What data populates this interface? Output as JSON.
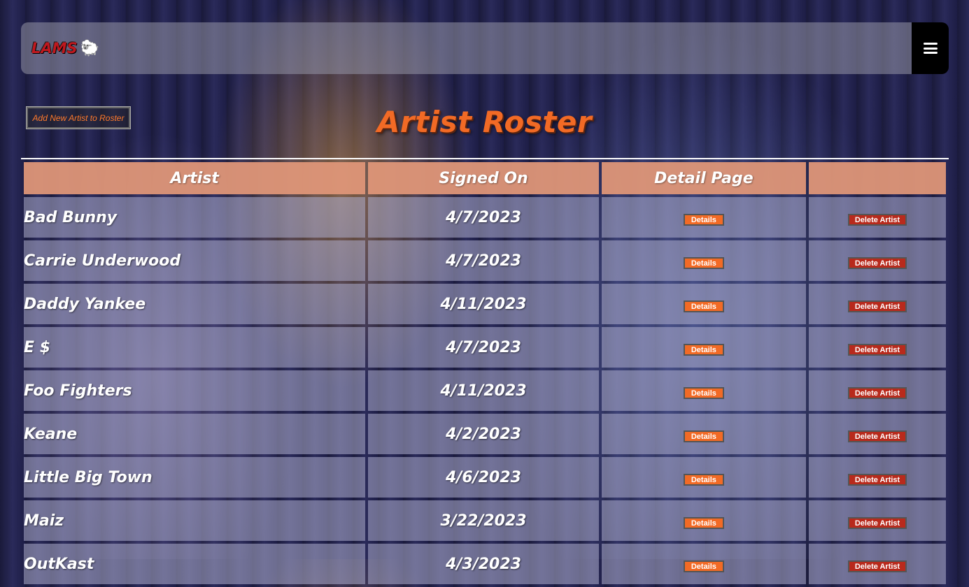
{
  "navbar": {
    "brand": "LAMS",
    "brand_emoji": "🐑",
    "menu_icon": "hamburger-menu-icon"
  },
  "actions": {
    "add_artist_label": "Add New Artist to Roster"
  },
  "page": {
    "title": "Artist Roster"
  },
  "table": {
    "headers": [
      "Artist",
      "Signed On",
      "Detail Page",
      ""
    ],
    "details_label": "Details",
    "delete_label": "Delete Artist",
    "rows": [
      {
        "artist": "Bad Bunny",
        "signed_on": "4/7/2023"
      },
      {
        "artist": "Carrie Underwood",
        "signed_on": "4/7/2023"
      },
      {
        "artist": "Daddy Yankee",
        "signed_on": "4/11/2023"
      },
      {
        "artist": "E $",
        "signed_on": "4/7/2023"
      },
      {
        "artist": "Foo Fighters",
        "signed_on": "4/11/2023"
      },
      {
        "artist": "Keane",
        "signed_on": "4/2/2023"
      },
      {
        "artist": "Little Big Town",
        "signed_on": "4/6/2023"
      },
      {
        "artist": "Maiz",
        "signed_on": "3/22/2023"
      },
      {
        "artist": "OutKast",
        "signed_on": "4/3/2023"
      }
    ]
  },
  "colors": {
    "accent_orange": "#f26a25",
    "delete_red": "#b82a1c",
    "header_salmon": "#de9678",
    "brand_red": "#c0181e"
  }
}
